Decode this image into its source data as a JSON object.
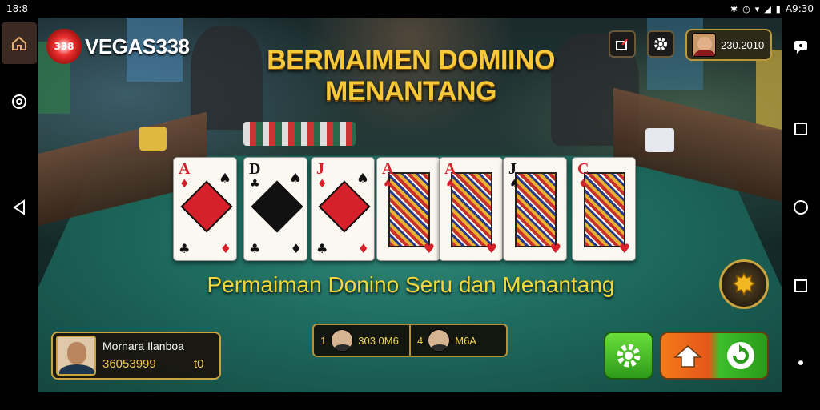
{
  "status_bar": {
    "time_left": "18:8",
    "time_right": "A9:30",
    "icons": [
      "bluetooth-icon",
      "alarm-icon",
      "wifi-icon",
      "signal-icon",
      "battery-icon"
    ]
  },
  "system_nav": {
    "left": [
      "home-icon",
      "record-icon",
      "back-icon"
    ],
    "right": [
      "chat-bubble-icon",
      "square-icon",
      "circle-icon",
      "square-icon",
      "dot-icon"
    ]
  },
  "header": {
    "logo_text": "VEGAS338",
    "title": "BERMAIMEN DOMIINO MENANTANG",
    "profile_value": "230.2010"
  },
  "cards": [
    {
      "rank": "A",
      "suit": "♦",
      "color": "red",
      "type": "pip"
    },
    {
      "rank": "D",
      "suit": "♣",
      "color": "black",
      "type": "pip"
    },
    {
      "rank": "J",
      "suit": "♦",
      "color": "red",
      "type": "pip"
    },
    {
      "rank": "A",
      "suit": "♠",
      "color": "red",
      "type": "face"
    },
    {
      "rank": "A",
      "suit": "♠",
      "color": "red",
      "type": "face"
    },
    {
      "rank": "J",
      "suit": "♠",
      "color": "black",
      "type": "face"
    },
    {
      "rank": "C",
      "suit": "♦",
      "color": "red",
      "type": "face"
    }
  ],
  "subtitle": "Permaiman Donino Seru dan Menantang",
  "player": {
    "name": "Mornara Ilanboa",
    "coins": "36053999",
    "extra": "t0"
  },
  "scores": [
    {
      "index": "1",
      "value": "303 0M6"
    },
    {
      "index": "4",
      "value": "M6A"
    }
  ],
  "colors": {
    "gold": "#f7c93a",
    "felt": "#1f6d60",
    "green_button": "#2d9a1a",
    "orange_button": "#e5561a"
  }
}
